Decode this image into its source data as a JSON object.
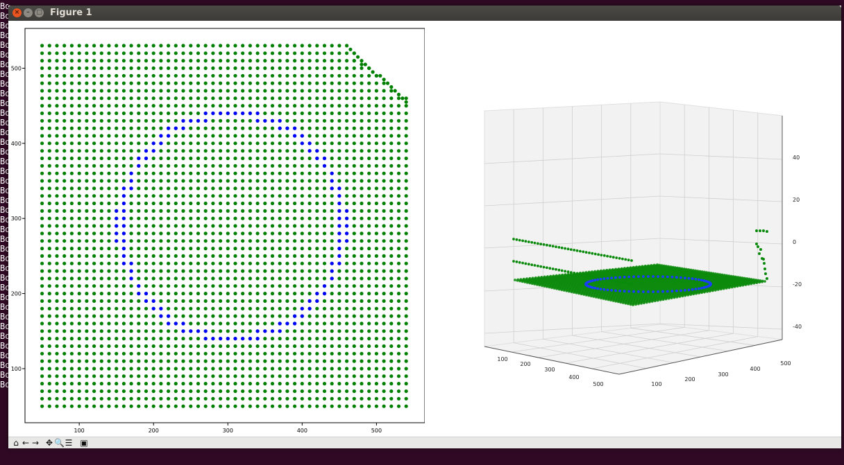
{
  "window": {
    "title": "Figure 1",
    "terminal_fragment": "Bo",
    "terminal_rows": 40
  },
  "toolbar": {
    "buttons": [
      {
        "name": "home",
        "glyph": "⌂"
      },
      {
        "name": "back",
        "glyph": "←"
      },
      {
        "name": "forward",
        "glyph": "→"
      },
      {
        "name": "pan",
        "glyph": "✥"
      },
      {
        "name": "zoom",
        "glyph": "🔍"
      },
      {
        "name": "configure",
        "glyph": "☰"
      },
      {
        "name": "save",
        "glyph": "▣"
      }
    ]
  },
  "colors": {
    "green": "#008000",
    "blue": "#0000ff",
    "titlebar": "#3c3b37",
    "close": "#e95420"
  },
  "chart_data": [
    {
      "type": "scatter",
      "title": "",
      "xlabel": "",
      "ylabel": "",
      "xlim": [
        27,
        565
      ],
      "ylim": [
        28,
        553
      ],
      "xticks": [
        100,
        200,
        300,
        400,
        500
      ],
      "yticks": [
        100,
        200,
        300,
        400,
        500
      ],
      "grid": false,
      "series": [
        {
          "color": "#008000",
          "description_of_points": "regular grid",
          "grid": {
            "x_start": 50,
            "x_end": 540,
            "x_step": 10,
            "y_start": 50,
            "y_end": 530,
            "y_step": 10
          },
          "outliers_top_right": [
            [
              465,
              525
            ],
            [
              470,
              520
            ],
            [
              475,
              515
            ],
            [
              470,
              510
            ],
            [
              480,
              505
            ],
            [
              485,
              505
            ],
            [
              490,
              500
            ],
            [
              495,
              495
            ],
            [
              500,
              490
            ],
            [
              505,
              490
            ],
            [
              510,
              485
            ],
            [
              515,
              480
            ],
            [
              520,
              475
            ],
            [
              525,
              470
            ],
            [
              530,
              465
            ],
            [
              535,
              460
            ],
            [
              540,
              455
            ]
          ]
        },
        {
          "color": "#0000ff",
          "description_of_points": "circle",
          "circle": {
            "cx": 305,
            "cy": 290,
            "r": 150
          }
        }
      ]
    },
    {
      "type": "scatter",
      "title": "",
      "xlabel": "",
      "ylabel": "",
      "zlabel": "",
      "xticks": [
        100,
        200,
        300,
        400,
        500
      ],
      "yticks": [
        100,
        200,
        300,
        400,
        500
      ],
      "zticks": [
        40,
        20,
        0,
        -20,
        -40
      ],
      "xlim": [
        0,
        560
      ],
      "ylim": [
        0,
        560
      ],
      "zlim": [
        -50,
        50
      ],
      "series": [
        {
          "color": "#008000",
          "description_of_points": "plane at z=-20 over x,y in [50,540]"
        },
        {
          "color": "#0000ff",
          "description_of_points": "circle on plane"
        }
      ]
    }
  ]
}
